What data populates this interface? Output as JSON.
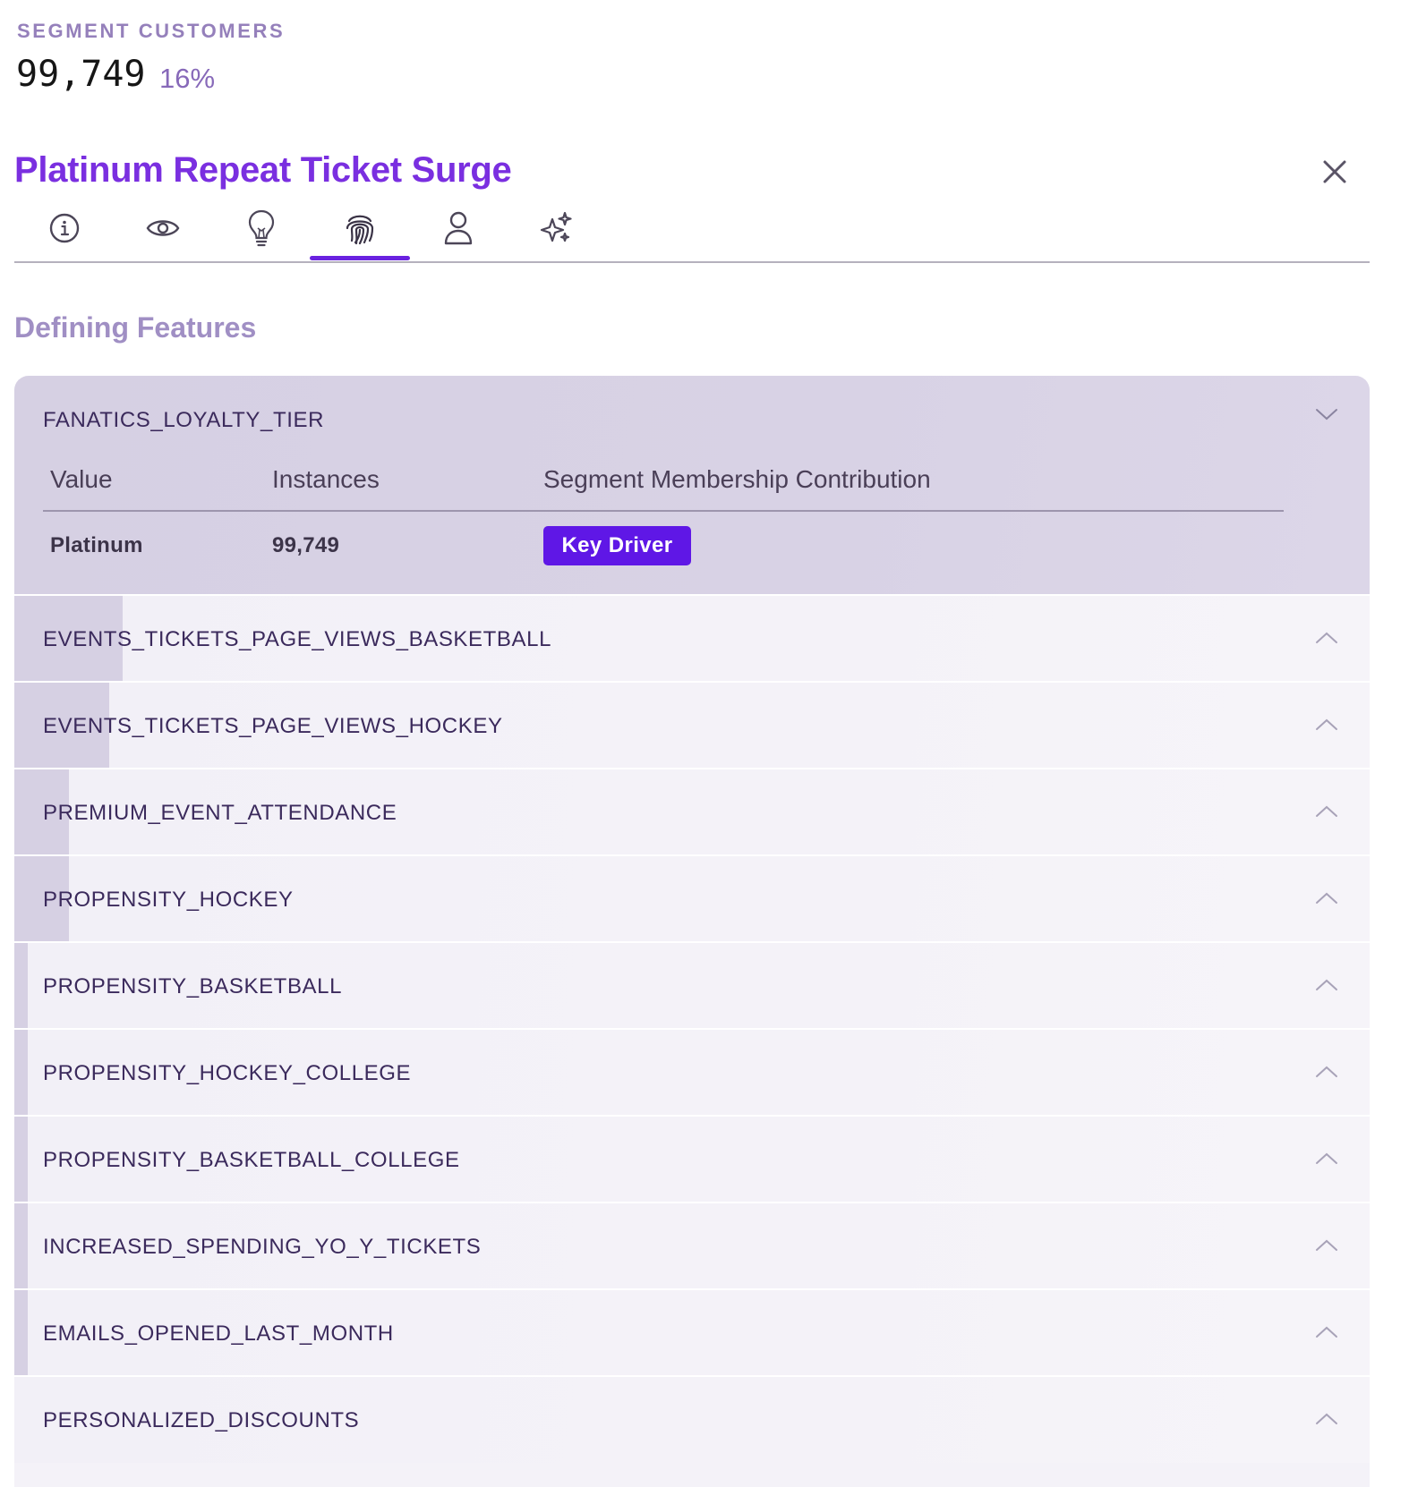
{
  "segment": {
    "label": "SEGMENT CUSTOMERS",
    "count": "99,749",
    "percent": "16%"
  },
  "title": "Platinum Repeat Ticket Surge",
  "tabs": [
    {
      "icon": "info-icon",
      "active": false
    },
    {
      "icon": "eye-icon",
      "active": false
    },
    {
      "icon": "lightbulb-icon",
      "active": false
    },
    {
      "icon": "fingerprint-icon",
      "active": true
    },
    {
      "icon": "person-icon",
      "active": false
    },
    {
      "icon": "sparkles-icon",
      "active": false
    }
  ],
  "section_title": "Defining Features",
  "expanded_feature": {
    "name": "FANATICS_LOYALTY_TIER",
    "columns": [
      "Value",
      "Instances",
      "Segment Membership Contribution"
    ],
    "rows": [
      {
        "value": "Platinum",
        "instances": "99,749",
        "contribution": "Key Driver"
      }
    ]
  },
  "features": [
    {
      "name": "EVENTS_TICKETS_PAGE_VIEWS_BASKETBALL",
      "weight": 0.08
    },
    {
      "name": "EVENTS_TICKETS_PAGE_VIEWS_HOCKEY",
      "weight": 0.07
    },
    {
      "name": "PREMIUM_EVENT_ATTENDANCE",
      "weight": 0.04
    },
    {
      "name": "PROPENSITY_HOCKEY",
      "weight": 0.04
    },
    {
      "name": "PROPENSITY_BASKETBALL",
      "weight": 0.01
    },
    {
      "name": "PROPENSITY_HOCKEY_COLLEGE",
      "weight": 0.01
    },
    {
      "name": "PROPENSITY_BASKETBALL_COLLEGE",
      "weight": 0.01
    },
    {
      "name": "INCREASED_SPENDING_YO_Y_TICKETS",
      "weight": 0.01
    },
    {
      "name": "EMAILS_OPENED_LAST_MONTH",
      "weight": 0.01
    },
    {
      "name": "PERSONALIZED_DISCOUNTS",
      "weight": 0.0
    }
  ],
  "colors": {
    "accent": "#6a22e0",
    "title": "#7a2fe0",
    "key_driver_bg": "#5f17e6",
    "expanded_bg": "#d6d0e3",
    "row_bg": "#f4f2f8"
  }
}
